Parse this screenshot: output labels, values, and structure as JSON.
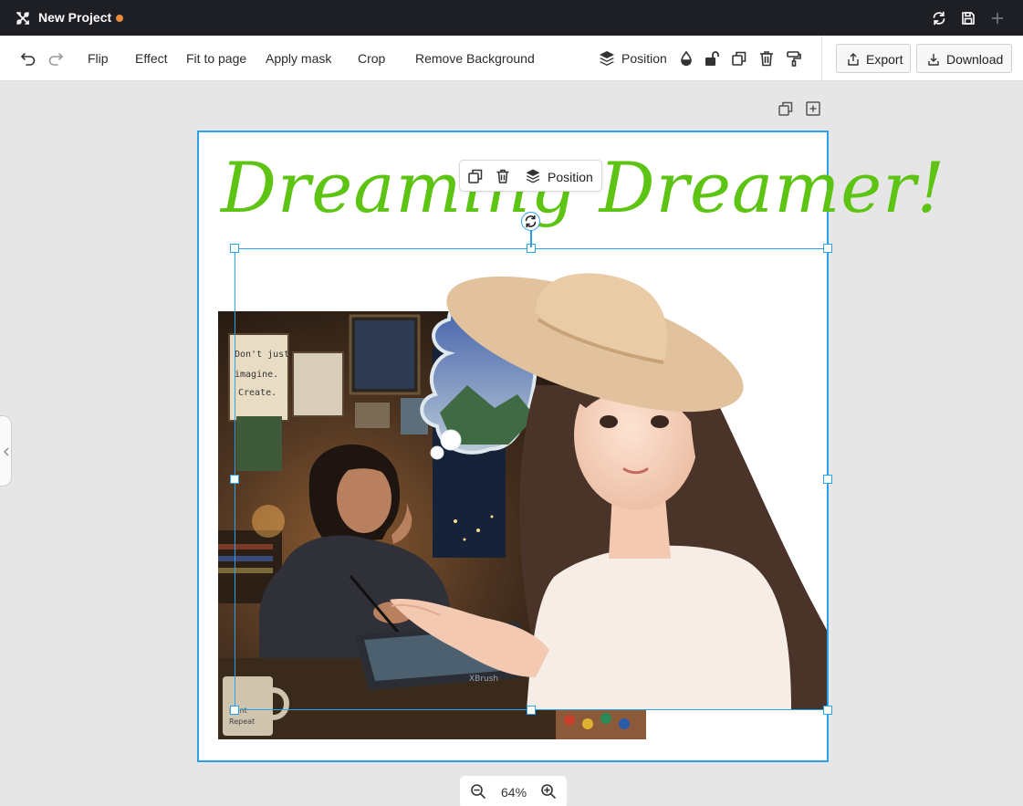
{
  "app": {
    "title": "New Project",
    "unsaved_dot_color": "#ef8a3a"
  },
  "toolbar": {
    "flip": "Flip",
    "effect": "Effect",
    "fit_to_page": "Fit to page",
    "apply_mask": "Apply mask",
    "crop": "Crop",
    "remove_background": "Remove Background",
    "position": "Position",
    "export": "Export",
    "download": "Download"
  },
  "canvas": {
    "headline": "Dreaming Dreamer!",
    "headline_color": "#5ec414",
    "selection_color": "#2ba1e9",
    "floating_toolbar": {
      "position": "Position"
    },
    "images": [
      {
        "name": "sticky-note",
        "text": "Don't just imagine. Create."
      },
      {
        "name": "tablet-brand",
        "text": "XBrush"
      },
      {
        "name": "mug-label",
        "text": "Paint Repeat"
      }
    ]
  },
  "zoom": {
    "value": "64%"
  }
}
